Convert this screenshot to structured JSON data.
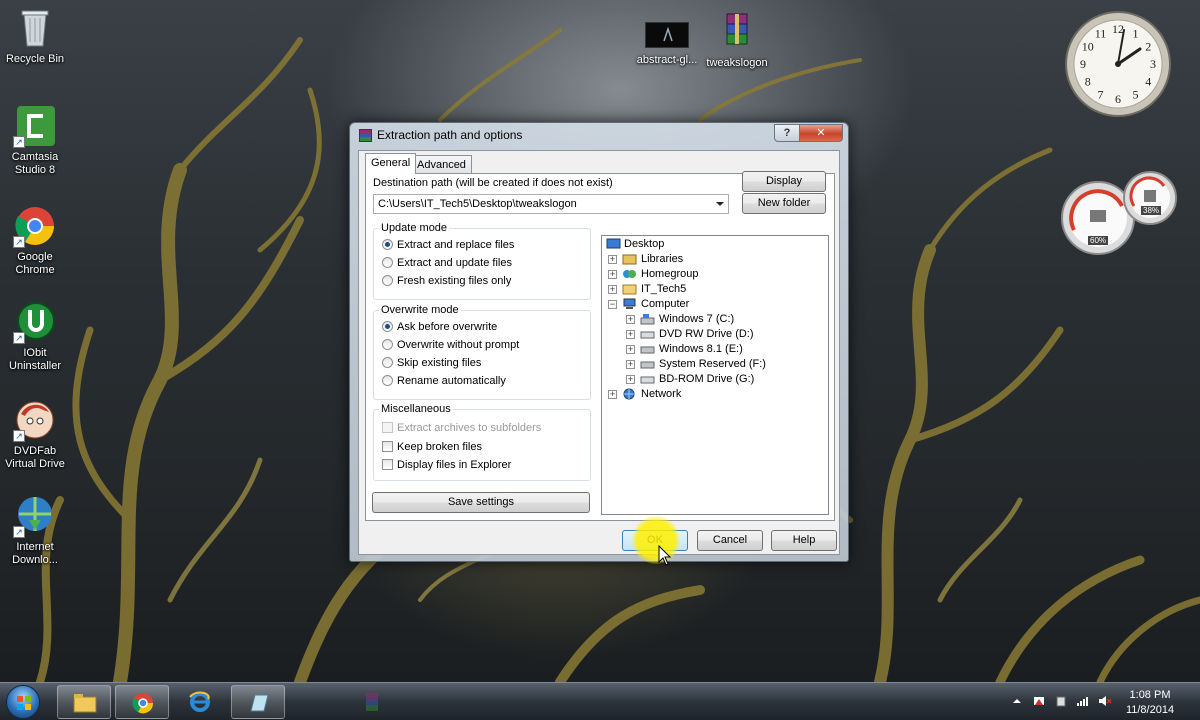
{
  "desktop": {
    "icons": [
      {
        "label": "Recycle Bin"
      },
      {
        "label": "Camtasia Studio 8"
      },
      {
        "label": "Google Chrome"
      },
      {
        "label": "IObit Uninstaller"
      },
      {
        "label": "DVDFab Virtual Drive"
      },
      {
        "label": "Internet Downlo..."
      },
      {
        "label": "abstract-gl..."
      },
      {
        "label": "tweakslogon"
      }
    ]
  },
  "gadgets": {
    "clock_numbers": [
      "12",
      "1",
      "2",
      "3",
      "4",
      "5",
      "6",
      "7",
      "8",
      "9",
      "10",
      "11"
    ],
    "cpu_percent": "60%",
    "memory_percent": "38%"
  },
  "dialog": {
    "title": "Extraction path and options",
    "tabs": [
      {
        "label": "General"
      },
      {
        "label": "Advanced"
      }
    ],
    "destination": {
      "label": "Destination path (will be created if does not exist)",
      "value": "C:\\Users\\IT_Tech5\\Desktop\\tweakslogon"
    },
    "buttons": {
      "display": "Display",
      "new_folder": "New folder",
      "save_settings": "Save settings",
      "ok": "OK",
      "cancel": "Cancel",
      "help": "Help"
    },
    "update_mode": {
      "title": "Update mode",
      "options": [
        {
          "label": "Extract and replace files",
          "selected": true
        },
        {
          "label": "Extract and update files",
          "selected": false
        },
        {
          "label": "Fresh existing files only",
          "selected": false
        }
      ]
    },
    "overwrite_mode": {
      "title": "Overwrite mode",
      "options": [
        {
          "label": "Ask before overwrite",
          "selected": true
        },
        {
          "label": "Overwrite without prompt",
          "selected": false
        },
        {
          "label": "Skip existing files",
          "selected": false
        },
        {
          "label": "Rename automatically",
          "selected": false
        }
      ]
    },
    "misc": {
      "title": "Miscellaneous",
      "options": [
        {
          "label": "Extract archives to subfolders",
          "checked": false,
          "enabled": false
        },
        {
          "label": "Keep broken files",
          "checked": false,
          "enabled": true
        },
        {
          "label": "Display files in Explorer",
          "checked": false,
          "enabled": true
        }
      ]
    },
    "tree": [
      {
        "label": "Desktop",
        "icon": "desktop-icon"
      },
      {
        "label": "Libraries",
        "icon": "library-icon"
      },
      {
        "label": "Homegroup",
        "icon": "homegroup-icon"
      },
      {
        "label": "IT_Tech5",
        "icon": "user-folder-icon"
      },
      {
        "label": "Computer",
        "icon": "computer-icon"
      },
      {
        "label": "Windows 7 (C:)",
        "icon": "drive-icon"
      },
      {
        "label": "DVD RW Drive (D:)",
        "icon": "dvd-drive-icon"
      },
      {
        "label": "Windows 8.1 (E:)",
        "icon": "drive-icon"
      },
      {
        "label": "System Reserved (F:)",
        "icon": "drive-icon"
      },
      {
        "label": "BD-ROM Drive (G:)",
        "icon": "bd-drive-icon"
      },
      {
        "label": "Network",
        "icon": "network-icon"
      }
    ]
  },
  "taskbar": {
    "time": "1:08 PM",
    "date": "11/8/2014"
  },
  "colors": {
    "accent_highlight": "#fff000",
    "taskbar": "#2d343c",
    "close_button": "#c8442c"
  }
}
